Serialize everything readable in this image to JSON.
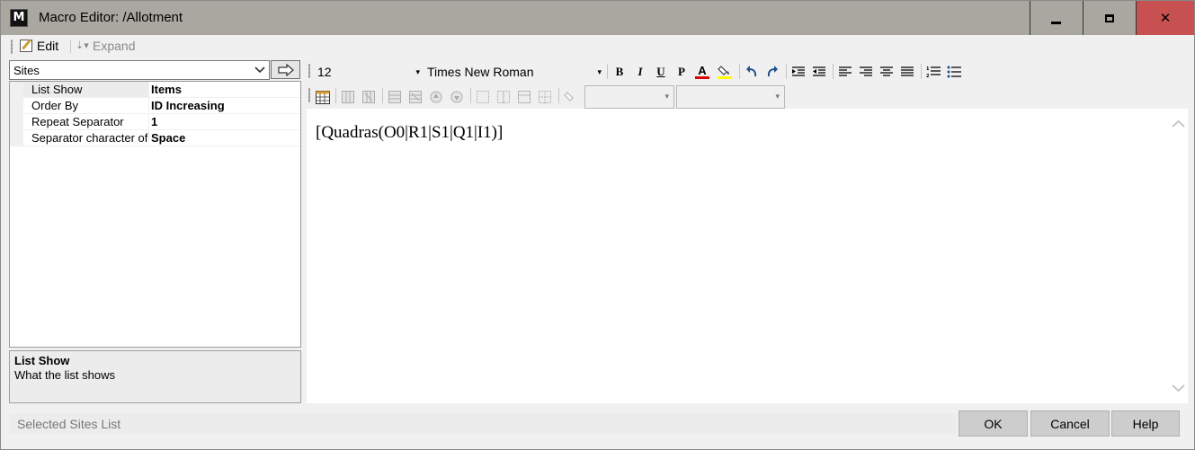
{
  "window": {
    "app_icon_letter": "M",
    "title": "Macro Editor: /Allotment"
  },
  "menu": {
    "edit": "Edit",
    "expand": "Expand"
  },
  "left": {
    "combo_value": "Sites",
    "properties": [
      {
        "name": "List Show",
        "value": "Items",
        "selected": true
      },
      {
        "name": "Order By",
        "value": "ID Increasing",
        "selected": false
      },
      {
        "name": "Repeat Separator",
        "value": "1",
        "selected": false
      },
      {
        "name": "Separator character of",
        "value": "Space",
        "selected": false
      }
    ],
    "help": {
      "title": "List Show",
      "description": "What the list shows"
    }
  },
  "toolbar": {
    "font_size": "12",
    "font_name": "Times New Roman",
    "bold": "B",
    "italic": "I",
    "underline": "U",
    "paragraph": "P",
    "font_color_letter": "A",
    "font_color": "#e00000",
    "highlight_color": "#ffff00"
  },
  "editor": {
    "content": "[Quadras(O0|R1|S1|Q1|I1)]"
  },
  "status": {
    "text": "Selected Sites List"
  },
  "buttons": {
    "ok": "OK",
    "cancel": "Cancel",
    "help": "Help"
  }
}
